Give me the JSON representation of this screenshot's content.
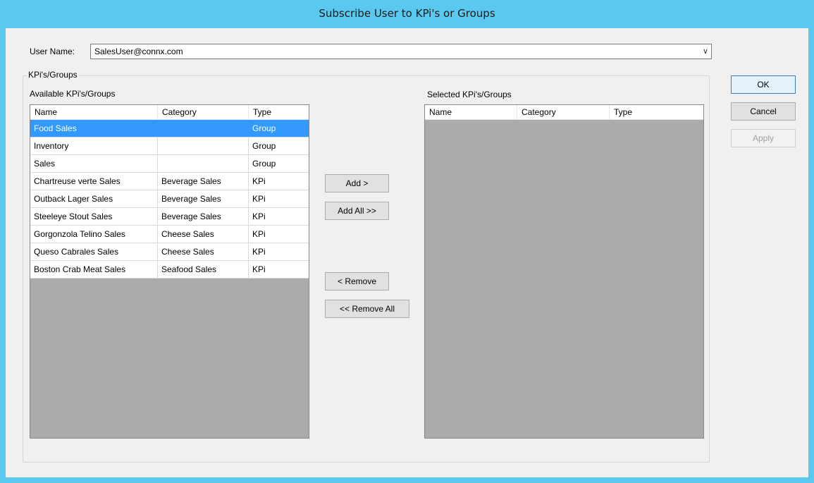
{
  "window": {
    "title": "Subscribe User to KPi's or Groups"
  },
  "user": {
    "label": "User Name:",
    "value": "SalesUser@connx.com"
  },
  "group": {
    "title": "KPi's/Groups"
  },
  "available": {
    "label": "Available KPi's/Groups",
    "columns": [
      "Name",
      "Category",
      "Type"
    ],
    "rows": [
      [
        "Food Sales",
        "",
        "Group"
      ],
      [
        "Inventory",
        "",
        "Group"
      ],
      [
        "Sales",
        "",
        "Group"
      ],
      [
        "Chartreuse verte Sales",
        "Beverage Sales",
        "KPi"
      ],
      [
        "Outback Lager Sales",
        "Beverage Sales",
        "KPi"
      ],
      [
        "Steeleye Stout Sales",
        "Beverage Sales",
        "KPi"
      ],
      [
        "Gorgonzola Telino Sales",
        "Cheese Sales",
        "KPi"
      ],
      [
        "Queso Cabrales Sales",
        "Cheese Sales",
        "KPi"
      ],
      [
        "Boston Crab Meat Sales",
        "Seafood Sales",
        "KPi"
      ]
    ],
    "selected_row": 0
  },
  "selected": {
    "label": "Selected KPi's/Groups",
    "columns": [
      "Name",
      "Category",
      "Type"
    ]
  },
  "transfer": {
    "add": "Add >",
    "add_all": "Add All >>",
    "remove": "< Remove",
    "remove_all": "<< Remove All"
  },
  "dialog": {
    "ok": "OK",
    "cancel": "Cancel",
    "apply": "Apply"
  },
  "colors": {
    "titlebar": "#5bc8ef",
    "selection": "#3399ff",
    "list_empty": "#ababab"
  }
}
